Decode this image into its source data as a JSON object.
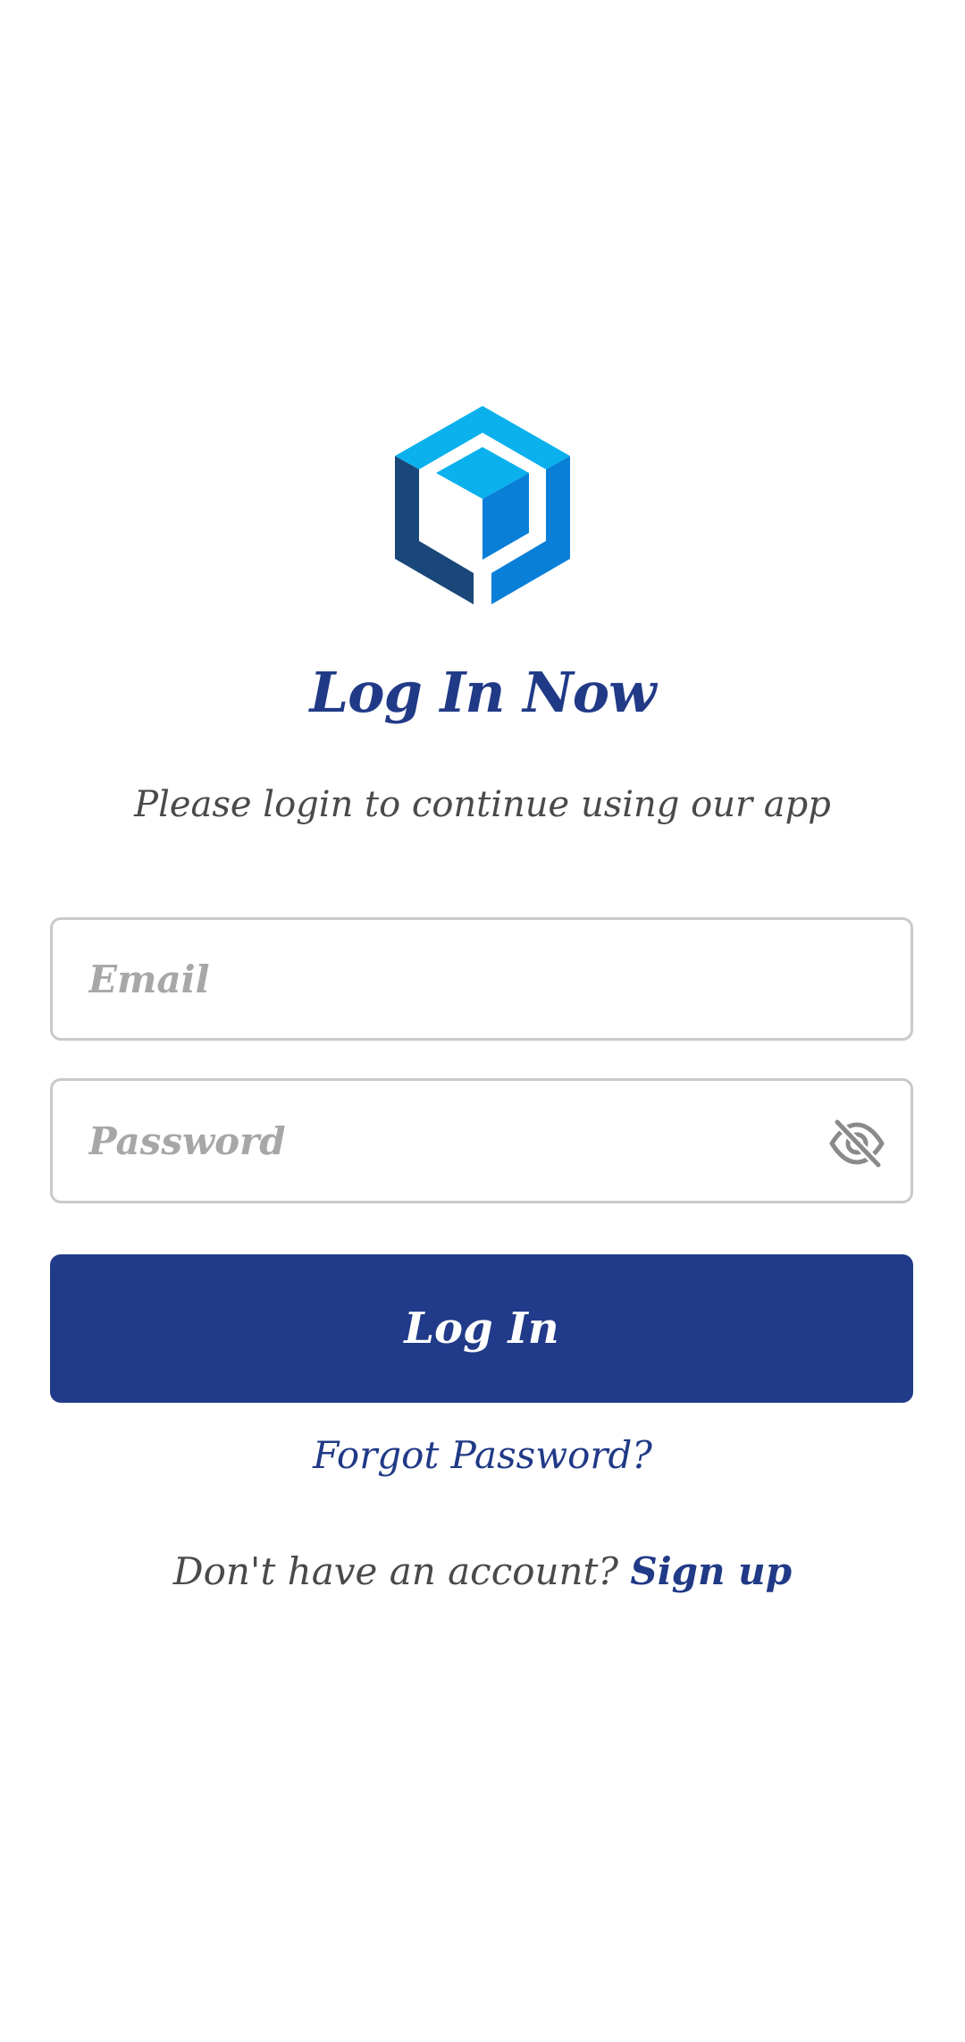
{
  "logo": {
    "icon": "cube-icon",
    "colors": {
      "top": "#0ab1ec",
      "left": "#1a4779",
      "right": "#0a7fd8",
      "inner_top": "#0ab1ec",
      "inner_right": "#0a7fd8"
    }
  },
  "header": {
    "title": "Log In Now",
    "subtitle": "Please login to continue using our app"
  },
  "form": {
    "email": {
      "placeholder": "Email",
      "value": ""
    },
    "password": {
      "placeholder": "Password",
      "value": "",
      "toggle_icon": "eye-off-icon"
    },
    "login_label": "Log In",
    "forgot_label": "Forgot Password?"
  },
  "footer": {
    "prompt": "Don't have an account?",
    "signup_label": "Sign up"
  },
  "colors": {
    "primary": "#213a89",
    "text_muted": "#4a4a4a",
    "placeholder": "#a7a7a7",
    "border": "#c9c9c9",
    "background": "#ffffff"
  }
}
